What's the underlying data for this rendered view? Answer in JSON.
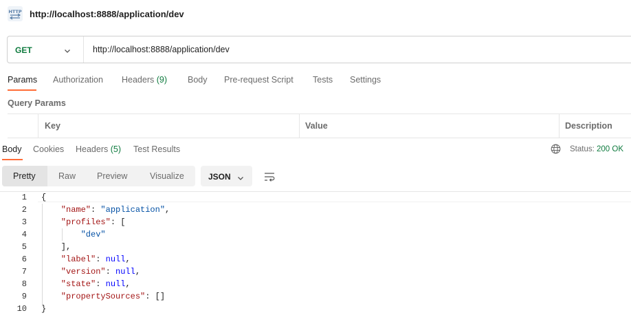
{
  "header": {
    "icon": "http-request-icon",
    "title": "http://localhost:8888/application/dev"
  },
  "request": {
    "method": "GET",
    "url": "http://localhost:8888/application/dev"
  },
  "request_tabs": [
    {
      "label": "Params",
      "count": "",
      "active": true
    },
    {
      "label": "Authorization",
      "count": "",
      "active": false
    },
    {
      "label": "Headers",
      "count": "(9)",
      "active": false
    },
    {
      "label": "Body",
      "count": "",
      "active": false
    },
    {
      "label": "Pre-request Script",
      "count": "",
      "active": false
    },
    {
      "label": "Tests",
      "count": "",
      "active": false
    },
    {
      "label": "Settings",
      "count": "",
      "active": false
    }
  ],
  "query_params": {
    "title": "Query Params",
    "columns": [
      "Key",
      "Value",
      "Description"
    ]
  },
  "response_tabs": [
    {
      "label": "Body",
      "count": "",
      "active": true
    },
    {
      "label": "Cookies",
      "count": "",
      "active": false
    },
    {
      "label": "Headers",
      "count": "(5)",
      "active": false
    },
    {
      "label": "Test Results",
      "count": "",
      "active": false
    }
  ],
  "status": {
    "label": "Status:",
    "value": "200 OK"
  },
  "view_tabs": [
    "Pretty",
    "Raw",
    "Preview",
    "Visualize"
  ],
  "format": "JSON",
  "code_lines": [
    {
      "n": "1",
      "t": "{"
    },
    {
      "n": "2",
      "k": "\"name\"",
      "v": "\"application\"",
      "c": ","
    },
    {
      "n": "3",
      "k": "\"profiles\"",
      "r": "["
    },
    {
      "n": "4",
      "v": "\"dev\""
    },
    {
      "n": "5",
      "r": "],"
    },
    {
      "n": "6",
      "k": "\"label\"",
      "nl": "null",
      "c": ","
    },
    {
      "n": "7",
      "k": "\"version\"",
      "nl": "null",
      "c": ","
    },
    {
      "n": "8",
      "k": "\"state\"",
      "nl": "null",
      "c": ","
    },
    {
      "n": "9",
      "k": "\"propertySources\"",
      "r": "[]"
    },
    {
      "n": "10",
      "t": "}"
    }
  ],
  "colors": {
    "accent": "#ff6c37",
    "method_get": "#0f7b3f",
    "status_ok": "#0f7b3f",
    "json_key": "#a31515",
    "json_string": "#0451a5",
    "json_null": "#0000ff"
  }
}
